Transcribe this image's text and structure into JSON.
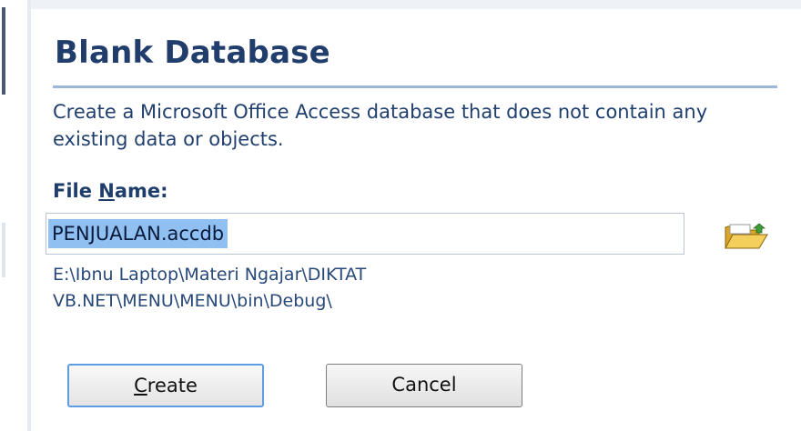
{
  "panel": {
    "title": "Blank Database",
    "description": "Create a Microsoft Office Access database that does not contain any existing data or objects."
  },
  "file_name": {
    "label_prefix": "File ",
    "label_accel": "N",
    "label_rest": "ame:",
    "value": "PENJUALAN.accdb",
    "path": "E:\\Ibnu Laptop\\Materi Ngajar\\DIKTAT VB.NET\\MENU\\MENU\\bin\\Debug\\"
  },
  "buttons": {
    "create_accel": "C",
    "create_rest": "reate",
    "cancel": "Cancel"
  },
  "icons": {
    "browse": "open-folder-icon"
  },
  "colors": {
    "title": "#213d6b",
    "selection": "#90bff2",
    "focus_border": "#5d9de0"
  }
}
